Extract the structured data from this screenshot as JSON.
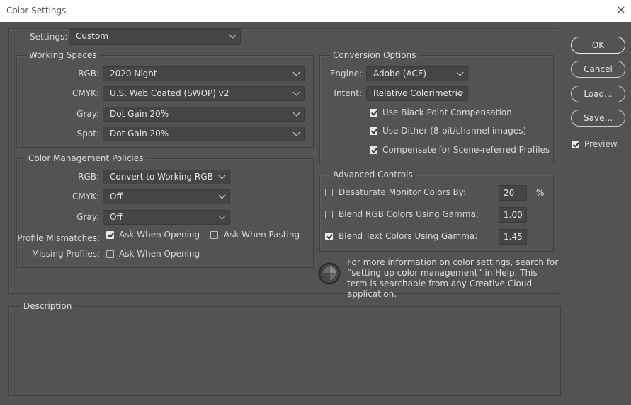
{
  "window": {
    "title": "Color Settings",
    "close_glyph": "✕"
  },
  "settings": {
    "label": "Settings:",
    "value": "Custom"
  },
  "working_spaces": {
    "title": "Working Spaces",
    "rgb": {
      "label": "RGB:",
      "value": "2020 Night"
    },
    "cmyk": {
      "label": "CMYK:",
      "value": "U.S. Web Coated (SWOP) v2"
    },
    "gray": {
      "label": "Gray:",
      "value": "Dot Gain 20%"
    },
    "spot": {
      "label": "Spot:",
      "value": "Dot Gain 20%"
    }
  },
  "policies": {
    "title": "Color Management Policies",
    "rgb": {
      "label": "RGB:",
      "value": "Convert to Working RGB"
    },
    "cmyk": {
      "label": "CMYK:",
      "value": "Off"
    },
    "gray": {
      "label": "Gray:",
      "value": "Off"
    },
    "mismatch_label": "Profile Mismatches:",
    "ask_opening": {
      "label": "Ask When Opening",
      "checked": true
    },
    "ask_pasting": {
      "label": "Ask When Pasting",
      "checked": false
    },
    "missing_label": "Missing Profiles:",
    "missing_ask_opening": {
      "label": "Ask When Opening",
      "checked": false
    }
  },
  "conversion": {
    "title": "Conversion Options",
    "engine": {
      "label": "Engine:",
      "value": "Adobe (ACE)"
    },
    "intent": {
      "label": "Intent:",
      "value": "Relative Colorimetric"
    },
    "black_point": {
      "label": "Use Black Point Compensation",
      "checked": true
    },
    "dither": {
      "label": "Use Dither (8-bit/channel images)",
      "checked": true
    },
    "scene_referred": {
      "label": "Compensate for Scene-referred Profiles",
      "checked": true
    }
  },
  "advanced": {
    "title": "Advanced Controls",
    "desaturate": {
      "label": "Desaturate Monitor Colors By:",
      "value": "20",
      "unit": "%",
      "checked": false
    },
    "blend_rgb": {
      "label": "Blend RGB Colors Using Gamma:",
      "value": "1.00",
      "checked": false
    },
    "blend_text": {
      "label": "Blend Text Colors Using Gamma:",
      "value": "1.45",
      "checked": true
    }
  },
  "info_text": "For more information on color settings, search for “setting up color management” in Help. This term is searchable from any Creative Cloud application.",
  "description": {
    "title": "Description"
  },
  "buttons": {
    "ok": "OK",
    "cancel": "Cancel",
    "load": "Load...",
    "save": "Save..."
  },
  "preview": {
    "label": "Preview",
    "checked": true
  },
  "colors": {
    "dialog_bg": "#535353",
    "field_bg": "#454545",
    "titlebar_bg": "#ffffff"
  }
}
